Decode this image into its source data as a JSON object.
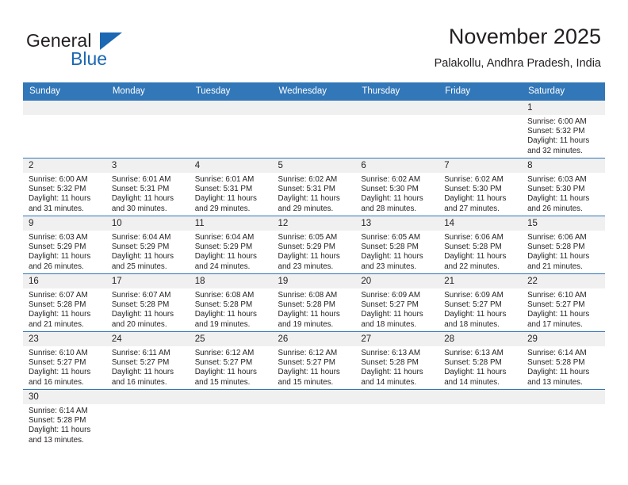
{
  "brand": {
    "name_part1": "General",
    "name_part2": "Blue",
    "triangle_color": "#1c68b3"
  },
  "header": {
    "title": "November 2025",
    "subtitle": "Palakollu, Andhra Pradesh, India"
  },
  "theme": {
    "header_blue": "#3277b8",
    "daynum_band": "#f0f0f0",
    "text": "#231f20"
  },
  "calendar": {
    "weekday_headers": [
      "Sunday",
      "Monday",
      "Tuesday",
      "Wednesday",
      "Thursday",
      "Friday",
      "Saturday"
    ],
    "weeks": [
      [
        {
          "day": "",
          "empty": true,
          "sunrise": "",
          "sunset": "",
          "daylight1": "",
          "daylight2": ""
        },
        {
          "day": "",
          "empty": true,
          "sunrise": "",
          "sunset": "",
          "daylight1": "",
          "daylight2": ""
        },
        {
          "day": "",
          "empty": true,
          "sunrise": "",
          "sunset": "",
          "daylight1": "",
          "daylight2": ""
        },
        {
          "day": "",
          "empty": true,
          "sunrise": "",
          "sunset": "",
          "daylight1": "",
          "daylight2": ""
        },
        {
          "day": "",
          "empty": true,
          "sunrise": "",
          "sunset": "",
          "daylight1": "",
          "daylight2": ""
        },
        {
          "day": "",
          "empty": true,
          "sunrise": "",
          "sunset": "",
          "daylight1": "",
          "daylight2": ""
        },
        {
          "day": "1",
          "empty": false,
          "sunrise": "Sunrise: 6:00 AM",
          "sunset": "Sunset: 5:32 PM",
          "daylight1": "Daylight: 11 hours",
          "daylight2": "and 32 minutes."
        }
      ],
      [
        {
          "day": "2",
          "empty": false,
          "sunrise": "Sunrise: 6:00 AM",
          "sunset": "Sunset: 5:32 PM",
          "daylight1": "Daylight: 11 hours",
          "daylight2": "and 31 minutes."
        },
        {
          "day": "3",
          "empty": false,
          "sunrise": "Sunrise: 6:01 AM",
          "sunset": "Sunset: 5:31 PM",
          "daylight1": "Daylight: 11 hours",
          "daylight2": "and 30 minutes."
        },
        {
          "day": "4",
          "empty": false,
          "sunrise": "Sunrise: 6:01 AM",
          "sunset": "Sunset: 5:31 PM",
          "daylight1": "Daylight: 11 hours",
          "daylight2": "and 29 minutes."
        },
        {
          "day": "5",
          "empty": false,
          "sunrise": "Sunrise: 6:02 AM",
          "sunset": "Sunset: 5:31 PM",
          "daylight1": "Daylight: 11 hours",
          "daylight2": "and 29 minutes."
        },
        {
          "day": "6",
          "empty": false,
          "sunrise": "Sunrise: 6:02 AM",
          "sunset": "Sunset: 5:30 PM",
          "daylight1": "Daylight: 11 hours",
          "daylight2": "and 28 minutes."
        },
        {
          "day": "7",
          "empty": false,
          "sunrise": "Sunrise: 6:02 AM",
          "sunset": "Sunset: 5:30 PM",
          "daylight1": "Daylight: 11 hours",
          "daylight2": "and 27 minutes."
        },
        {
          "day": "8",
          "empty": false,
          "sunrise": "Sunrise: 6:03 AM",
          "sunset": "Sunset: 5:30 PM",
          "daylight1": "Daylight: 11 hours",
          "daylight2": "and 26 minutes."
        }
      ],
      [
        {
          "day": "9",
          "empty": false,
          "sunrise": "Sunrise: 6:03 AM",
          "sunset": "Sunset: 5:29 PM",
          "daylight1": "Daylight: 11 hours",
          "daylight2": "and 26 minutes."
        },
        {
          "day": "10",
          "empty": false,
          "sunrise": "Sunrise: 6:04 AM",
          "sunset": "Sunset: 5:29 PM",
          "daylight1": "Daylight: 11 hours",
          "daylight2": "and 25 minutes."
        },
        {
          "day": "11",
          "empty": false,
          "sunrise": "Sunrise: 6:04 AM",
          "sunset": "Sunset: 5:29 PM",
          "daylight1": "Daylight: 11 hours",
          "daylight2": "and 24 minutes."
        },
        {
          "day": "12",
          "empty": false,
          "sunrise": "Sunrise: 6:05 AM",
          "sunset": "Sunset: 5:29 PM",
          "daylight1": "Daylight: 11 hours",
          "daylight2": "and 23 minutes."
        },
        {
          "day": "13",
          "empty": false,
          "sunrise": "Sunrise: 6:05 AM",
          "sunset": "Sunset: 5:28 PM",
          "daylight1": "Daylight: 11 hours",
          "daylight2": "and 23 minutes."
        },
        {
          "day": "14",
          "empty": false,
          "sunrise": "Sunrise: 6:06 AM",
          "sunset": "Sunset: 5:28 PM",
          "daylight1": "Daylight: 11 hours",
          "daylight2": "and 22 minutes."
        },
        {
          "day": "15",
          "empty": false,
          "sunrise": "Sunrise: 6:06 AM",
          "sunset": "Sunset: 5:28 PM",
          "daylight1": "Daylight: 11 hours",
          "daylight2": "and 21 minutes."
        }
      ],
      [
        {
          "day": "16",
          "empty": false,
          "sunrise": "Sunrise: 6:07 AM",
          "sunset": "Sunset: 5:28 PM",
          "daylight1": "Daylight: 11 hours",
          "daylight2": "and 21 minutes."
        },
        {
          "day": "17",
          "empty": false,
          "sunrise": "Sunrise: 6:07 AM",
          "sunset": "Sunset: 5:28 PM",
          "daylight1": "Daylight: 11 hours",
          "daylight2": "and 20 minutes."
        },
        {
          "day": "18",
          "empty": false,
          "sunrise": "Sunrise: 6:08 AM",
          "sunset": "Sunset: 5:28 PM",
          "daylight1": "Daylight: 11 hours",
          "daylight2": "and 19 minutes."
        },
        {
          "day": "19",
          "empty": false,
          "sunrise": "Sunrise: 6:08 AM",
          "sunset": "Sunset: 5:28 PM",
          "daylight1": "Daylight: 11 hours",
          "daylight2": "and 19 minutes."
        },
        {
          "day": "20",
          "empty": false,
          "sunrise": "Sunrise: 6:09 AM",
          "sunset": "Sunset: 5:27 PM",
          "daylight1": "Daylight: 11 hours",
          "daylight2": "and 18 minutes."
        },
        {
          "day": "21",
          "empty": false,
          "sunrise": "Sunrise: 6:09 AM",
          "sunset": "Sunset: 5:27 PM",
          "daylight1": "Daylight: 11 hours",
          "daylight2": "and 18 minutes."
        },
        {
          "day": "22",
          "empty": false,
          "sunrise": "Sunrise: 6:10 AM",
          "sunset": "Sunset: 5:27 PM",
          "daylight1": "Daylight: 11 hours",
          "daylight2": "and 17 minutes."
        }
      ],
      [
        {
          "day": "23",
          "empty": false,
          "sunrise": "Sunrise: 6:10 AM",
          "sunset": "Sunset: 5:27 PM",
          "daylight1": "Daylight: 11 hours",
          "daylight2": "and 16 minutes."
        },
        {
          "day": "24",
          "empty": false,
          "sunrise": "Sunrise: 6:11 AM",
          "sunset": "Sunset: 5:27 PM",
          "daylight1": "Daylight: 11 hours",
          "daylight2": "and 16 minutes."
        },
        {
          "day": "25",
          "empty": false,
          "sunrise": "Sunrise: 6:12 AM",
          "sunset": "Sunset: 5:27 PM",
          "daylight1": "Daylight: 11 hours",
          "daylight2": "and 15 minutes."
        },
        {
          "day": "26",
          "empty": false,
          "sunrise": "Sunrise: 6:12 AM",
          "sunset": "Sunset: 5:27 PM",
          "daylight1": "Daylight: 11 hours",
          "daylight2": "and 15 minutes."
        },
        {
          "day": "27",
          "empty": false,
          "sunrise": "Sunrise: 6:13 AM",
          "sunset": "Sunset: 5:28 PM",
          "daylight1": "Daylight: 11 hours",
          "daylight2": "and 14 minutes."
        },
        {
          "day": "28",
          "empty": false,
          "sunrise": "Sunrise: 6:13 AM",
          "sunset": "Sunset: 5:28 PM",
          "daylight1": "Daylight: 11 hours",
          "daylight2": "and 14 minutes."
        },
        {
          "day": "29",
          "empty": false,
          "sunrise": "Sunrise: 6:14 AM",
          "sunset": "Sunset: 5:28 PM",
          "daylight1": "Daylight: 11 hours",
          "daylight2": "and 13 minutes."
        }
      ],
      [
        {
          "day": "30",
          "empty": false,
          "sunrise": "Sunrise: 6:14 AM",
          "sunset": "Sunset: 5:28 PM",
          "daylight1": "Daylight: 11 hours",
          "daylight2": "and 13 minutes."
        },
        {
          "day": "",
          "empty": true,
          "sunrise": "",
          "sunset": "",
          "daylight1": "",
          "daylight2": ""
        },
        {
          "day": "",
          "empty": true,
          "sunrise": "",
          "sunset": "",
          "daylight1": "",
          "daylight2": ""
        },
        {
          "day": "",
          "empty": true,
          "sunrise": "",
          "sunset": "",
          "daylight1": "",
          "daylight2": ""
        },
        {
          "day": "",
          "empty": true,
          "sunrise": "",
          "sunset": "",
          "daylight1": "",
          "daylight2": ""
        },
        {
          "day": "",
          "empty": true,
          "sunrise": "",
          "sunset": "",
          "daylight1": "",
          "daylight2": ""
        },
        {
          "day": "",
          "empty": true,
          "sunrise": "",
          "sunset": "",
          "daylight1": "",
          "daylight2": ""
        }
      ]
    ]
  }
}
